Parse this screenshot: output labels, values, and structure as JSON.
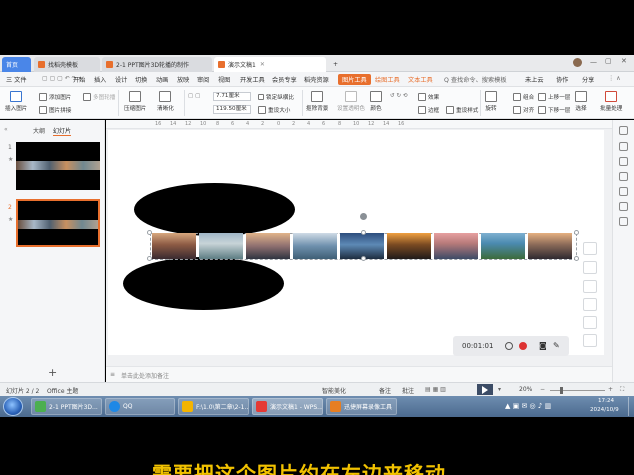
{
  "window": {
    "tabs": [
      {
        "label": "首页",
        "type": "home"
      },
      {
        "label": "找稻壳模板",
        "type": "normal"
      },
      {
        "label": "2-1 PPT图片3D轮播的制作",
        "type": "normal"
      },
      {
        "label": "演示文稿1",
        "type": "active"
      }
    ],
    "new_tab": "+"
  },
  "menu": {
    "file": "三 文件",
    "items": [
      "开始",
      "插入",
      "设计",
      "切换",
      "动画",
      "放映",
      "审阅",
      "视图",
      "开发工具",
      "会员专享",
      "稻壳资源"
    ],
    "tool_tabs": [
      "图片工具",
      "绘图工具",
      "文本工具"
    ],
    "search": "Q 查找命令、搜索模板",
    "sync": "未上云",
    "collab": "协作",
    "share": "分享"
  },
  "ribbon": {
    "insert_pic": "插入图片",
    "add_pic": "添加图片",
    "multi_pic": "多图轮播",
    "pic_onclick": "图片拼接",
    "compress": "压缩图片",
    "clarity": "清晰化",
    "height": "7.71厘米",
    "width": "119.50厘米",
    "lock_ratio": "锁定纵横比",
    "reset_size": "重设大小",
    "crop": "裁剪",
    "reset_shape": "重设形状",
    "remove_bg": "抠除背景",
    "set_transparent": "设置透明色",
    "color": "颜色",
    "effect": "效果",
    "border": "边框",
    "reset_style": "重设样式",
    "rotate": "旋转",
    "align": "对齐",
    "combine": "组合",
    "up_layer": "上移一层",
    "down_layer": "下移一层",
    "select": "选择",
    "batch": "批量处理"
  },
  "left_panel": {
    "tab_outline": "大纲",
    "tab_slides": "幻灯片",
    "slide_numbers": [
      "1",
      "2"
    ],
    "add": "+"
  },
  "ruler": [
    "16",
    "14",
    "12",
    "10",
    "8",
    "6",
    "4",
    "2",
    "0",
    "2",
    "4",
    "6",
    "8",
    "10",
    "12",
    "14",
    "16"
  ],
  "recorder": {
    "time": "00:01:01"
  },
  "notes": {
    "placeholder": "单击此处添加备注"
  },
  "status": {
    "slide_info": "幻灯片 2 / 2",
    "theme": "Office 主题",
    "beautify": "智能美化",
    "notes": "备注",
    "comment": "批注",
    "zoom": "20%"
  },
  "taskbar": {
    "items": [
      {
        "label": "2-1 PPT图片3D...",
        "color": "#4caf50"
      },
      {
        "label": "QQ",
        "color": "#1e88e5"
      },
      {
        "label": "F:\\1.0\\第二章\\2-1...",
        "color": "#f4b400"
      },
      {
        "label": "演示文稿1 - WPS...",
        "color": "#e53935"
      },
      {
        "label": "迅捷屏幕录像工具",
        "color": "#e67e22"
      }
    ],
    "time": "17:24",
    "date": "2024/10/9"
  },
  "subtitle": "需要把这个图片约在左边来移动",
  "colors": {
    "accent": "#e86f2d",
    "home_tab": "#4a86e8",
    "subtitle": "#f2c200"
  }
}
